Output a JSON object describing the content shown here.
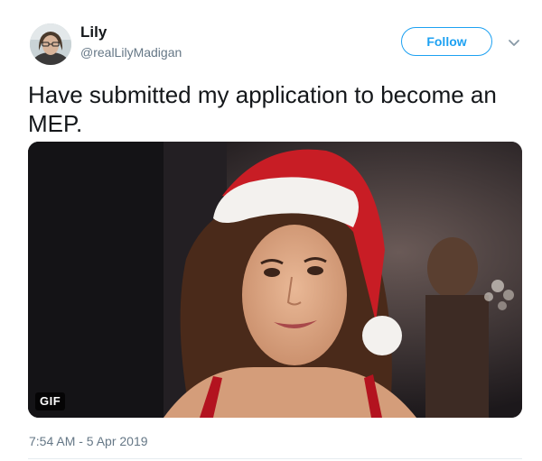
{
  "author": {
    "name": "Lily",
    "handle": "@realLilyMadigan"
  },
  "follow_button": {
    "label": "Follow"
  },
  "menu_caret": {
    "icon": "chevron-down-icon"
  },
  "tweet": {
    "text": "Have submitted my application to become an MEP."
  },
  "media": {
    "badge": "GIF"
  },
  "timestamp": "7:54 AM - 5 Apr 2019",
  "colors": {
    "accent": "#1da1f2",
    "secondary_text": "#657786",
    "primary_text": "#14171a"
  }
}
